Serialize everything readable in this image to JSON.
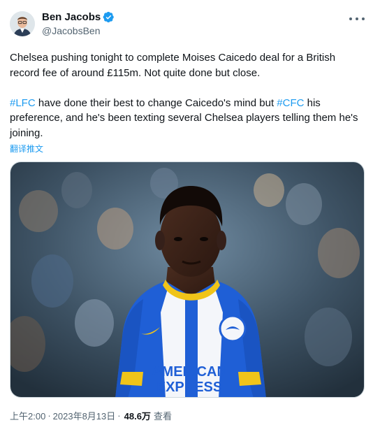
{
  "author": {
    "name": "Ben Jacobs",
    "handle": "@JacobsBen",
    "verified": true
  },
  "tweet": {
    "line1_pre": "Chelsea pushing tonight to complete Moises Caicedo deal for a British record fee of around £115m. Not quite done but close.",
    "hashtag_lfc": "#LFC",
    "text_mid": " have done their best to change Caicedo's mind but ",
    "hashtag_cfc": "#CFC",
    "text_end": " his preference, and he's been texting several Chelsea players telling them he's joining.",
    "flag_icon": "ecuador-flag-emoji",
    "translate_label": "翻译推文"
  },
  "media": {
    "shirt_sponsor_line1": "AMERICAN",
    "shirt_sponsor_line2": "EXPRESS"
  },
  "meta": {
    "time": "上午2:00",
    "separator": "·",
    "date": "2023年8月13日",
    "views_count": "48.6万",
    "views_label": "查看"
  },
  "colors": {
    "accent": "#1d9bf0",
    "secondary_text": "#536471",
    "primary_text": "#0f1419"
  }
}
